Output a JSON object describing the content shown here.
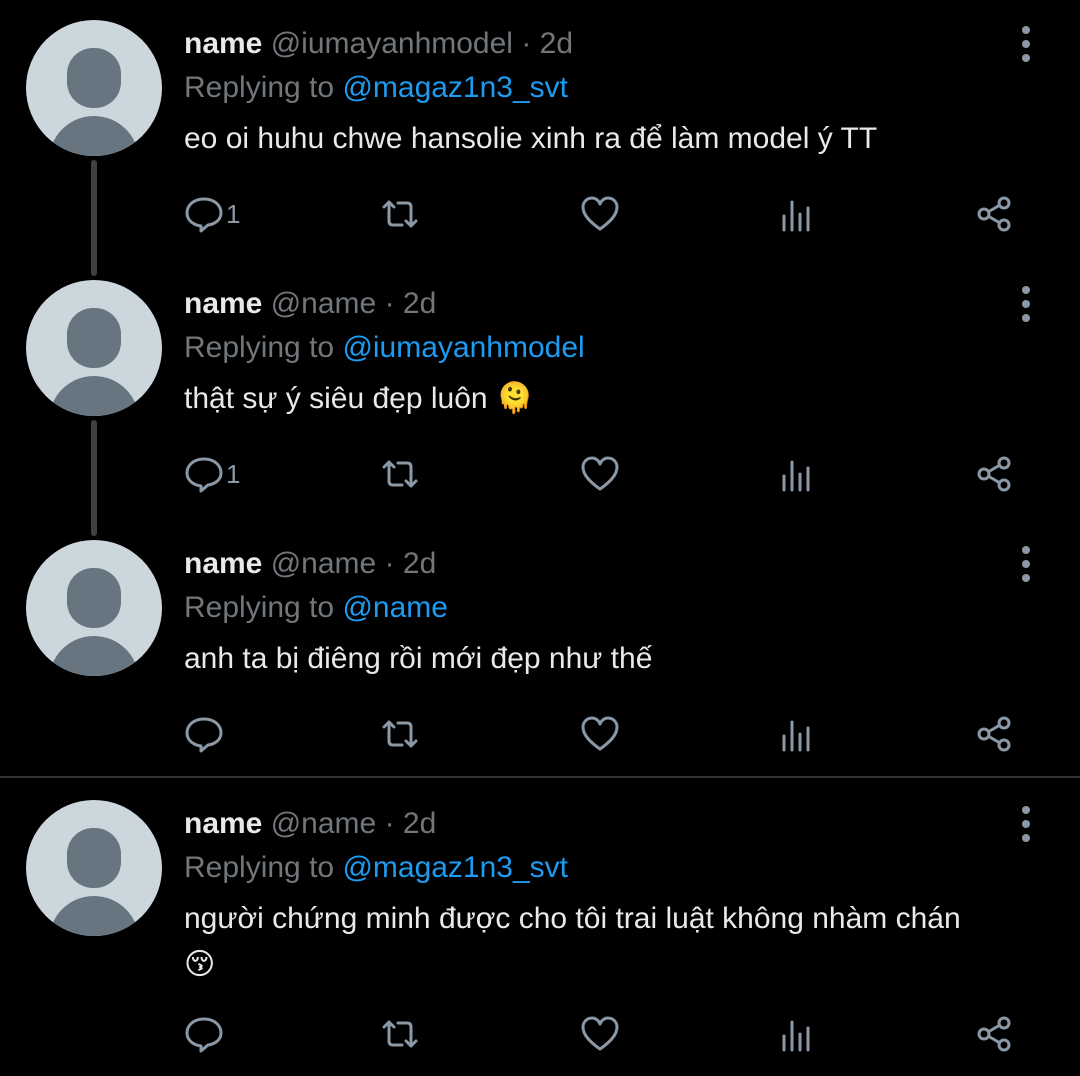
{
  "colors": {
    "background": "#000000",
    "text": "#e7e9ea",
    "muted": "#71767b",
    "mention": "#1d9bf0",
    "icon": "#8b98a5",
    "avatar_bg": "#ccd6dd",
    "avatar_fg": "#66757f"
  },
  "icons": {
    "reply": "reply-icon",
    "retweet": "retweet-icon",
    "like": "heart-icon",
    "views": "views-bar-chart-icon",
    "share": "share-icon",
    "more": "more-vertical-icon"
  },
  "tweets": [
    {
      "name": "name",
      "handle": "@iumayanhmodel",
      "sep": "·",
      "time": "2d",
      "replying_prefix": "Replying to",
      "replying_to": "@magaz1n3_svt",
      "text": "eo oi huhu chwe hansolie xinh ra để làm model ý TT",
      "emoji": "",
      "reply_count": "1"
    },
    {
      "name": "name",
      "handle": "@name",
      "sep": "·",
      "time": "2d",
      "replying_prefix": "Replying to",
      "replying_to": "@iumayanhmodel",
      "text": "thật sự ý siêu đẹp luôn",
      "emoji": "🫠",
      "reply_count": "1"
    },
    {
      "name": "name",
      "handle": "@name",
      "sep": "·",
      "time": "2d",
      "replying_prefix": "Replying to",
      "replying_to": "@name",
      "text": "anh ta bị điêng rồi mới đẹp như thế",
      "emoji": "",
      "reply_count": ""
    },
    {
      "name": "name",
      "handle": "@name",
      "sep": "·",
      "time": "2d",
      "replying_prefix": "Replying to",
      "replying_to": "@magaz1n3_svt",
      "text": "người chứng minh được cho tôi trai luật không nhàm chán",
      "emoji": "😚",
      "reply_count": ""
    }
  ]
}
